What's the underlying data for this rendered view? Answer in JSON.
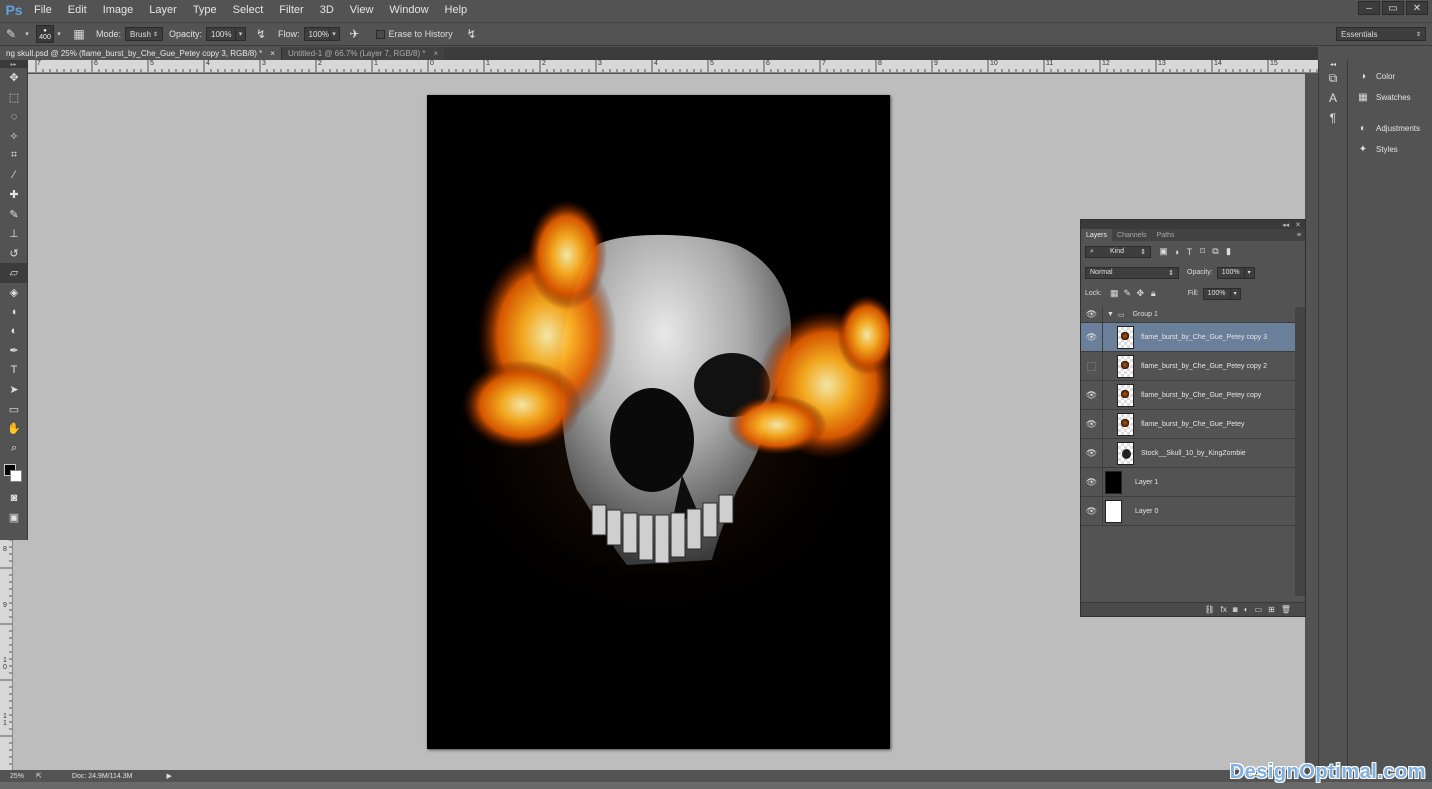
{
  "app": {
    "logo": "Ps"
  },
  "menu": [
    "File",
    "Edit",
    "Image",
    "Layer",
    "Type",
    "Select",
    "Filter",
    "3D",
    "View",
    "Window",
    "Help"
  ],
  "window_controls": [
    "–",
    "▭",
    "✕"
  ],
  "options": {
    "brush_size": "400",
    "mode_label": "Mode:",
    "mode_value": "Brush",
    "opacity_label": "Opacity:",
    "opacity_value": "100%",
    "flow_label": "Flow:",
    "flow_value": "100%",
    "erase_history_label": "Erase to History",
    "workspace": "Essentials"
  },
  "doc_tabs": [
    {
      "label": "ng skull.psd @ 25% (flame_burst_by_Che_Gue_Petey copy 3, RGB/8) *",
      "close": "×"
    },
    {
      "label": "Untitled-1 @ 66.7% (Layer 7, RGB/8) *",
      "close": "×"
    }
  ],
  "ruler_top": [
    "7",
    "6",
    "5",
    "4",
    "3",
    "2",
    "1",
    "0",
    "1",
    "2",
    "3",
    "4",
    "5",
    "6",
    "7",
    "8",
    "9",
    "10",
    "11",
    "12",
    "13",
    "14",
    "15"
  ],
  "ruler_left": [
    "1",
    "2",
    "3",
    "4",
    "5",
    "6",
    "7",
    "8",
    "9",
    "1 0",
    "1 1"
  ],
  "status": {
    "zoom": "25%",
    "doc": "Doc: 24.9M/114.3M"
  },
  "right_dock": [
    {
      "icon": "color-icon",
      "label": "Color"
    },
    {
      "icon": "swatches-icon",
      "label": "Swatches"
    },
    {
      "icon": "adjustments-icon",
      "label": "Adjustments"
    },
    {
      "icon": "styles-icon",
      "label": "Styles"
    }
  ],
  "layers_panel": {
    "tabs": [
      "Layers",
      "Channels",
      "Paths"
    ],
    "kind_label": "Kind",
    "blend_mode": "Normal",
    "opacity_label": "Opacity:",
    "opacity_value": "100%",
    "lock_label": "Lock:",
    "fill_label": "Fill:",
    "fill_value": "100%",
    "group_name": "Group 1",
    "layers": [
      {
        "name": "flame_burst_by_Che_Gue_Petey copy 3",
        "visible": true,
        "selected": true
      },
      {
        "name": "flame_burst_by_Che_Gue_Petey copy 2",
        "visible": false,
        "selected": false
      },
      {
        "name": "flame_burst_by_Che_Gue_Petey copy",
        "visible": true,
        "selected": false
      },
      {
        "name": "flame_burst_by_Che_Gue_Petey",
        "visible": true,
        "selected": false
      },
      {
        "name": "Stock__Skull_10_by_KingZombie",
        "visible": true,
        "selected": false
      },
      {
        "name": "Layer 1",
        "visible": true,
        "selected": false
      },
      {
        "name": "Layer 0",
        "visible": true,
        "selected": false
      }
    ]
  },
  "watermark": "DesignOptimal.com"
}
